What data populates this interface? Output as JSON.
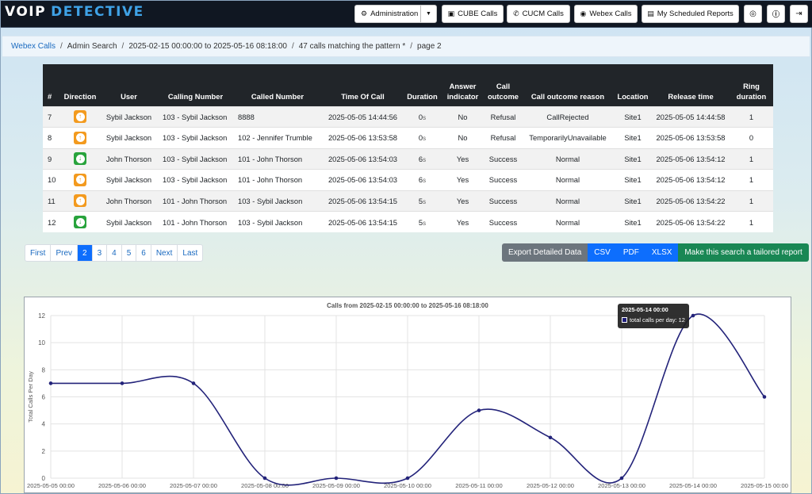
{
  "app": {
    "logo_a": "VOIP",
    "logo_b": "DETECTIVE"
  },
  "nav": {
    "administration": "Administration",
    "cube_calls": "CUBE Calls",
    "cucm_calls": "CUCM Calls",
    "webex_calls": "Webex Calls",
    "scheduled_reports": "My Scheduled Reports"
  },
  "breadcrumb": {
    "items": [
      "Webex Calls",
      "Admin Search",
      "2025-02-15 00:00:00 to 2025-05-16 08:18:00",
      "47 calls matching the pattern *",
      "page 2"
    ]
  },
  "table": {
    "headers": [
      "#",
      "Direction",
      "User",
      "Calling Number",
      "Called Number",
      "Time Of Call",
      "Duration",
      "Answer indicator",
      "Call outcome",
      "Call outcome reason",
      "Location",
      "Release time",
      "Ring duration"
    ],
    "rows": [
      {
        "num": "7",
        "direction": "outgoing",
        "user": "Sybil Jackson",
        "calling": "103 - Sybil Jackson",
        "called": "8888",
        "time": "2025-05-05 14:44:56",
        "duration": "0",
        "unit": "s",
        "answer": "No",
        "outcome": "Refusal",
        "reason": "CallRejected",
        "location": "Site1",
        "release": "2025-05-05 14:44:58",
        "ring": "1"
      },
      {
        "num": "8",
        "direction": "outgoing",
        "user": "Sybil Jackson",
        "calling": "103 - Sybil Jackson",
        "called": "102 - Jennifer Trumble",
        "time": "2025-05-06 13:53:58",
        "duration": "0",
        "unit": "s",
        "answer": "No",
        "outcome": "Refusal",
        "reason": "TemporarilyUnavailable",
        "location": "Site1",
        "release": "2025-05-06 13:53:58",
        "ring": "0"
      },
      {
        "num": "9",
        "direction": "incoming",
        "user": "John Thorson",
        "calling": "103 - Sybil Jackson",
        "called": "101 - John Thorson",
        "time": "2025-05-06 13:54:03",
        "duration": "6",
        "unit": "s",
        "answer": "Yes",
        "outcome": "Success",
        "reason": "Normal",
        "location": "Site1",
        "release": "2025-05-06 13:54:12",
        "ring": "1"
      },
      {
        "num": "10",
        "direction": "outgoing",
        "user": "Sybil Jackson",
        "calling": "103 - Sybil Jackson",
        "called": "101 - John Thorson",
        "time": "2025-05-06 13:54:03",
        "duration": "6",
        "unit": "s",
        "answer": "Yes",
        "outcome": "Success",
        "reason": "Normal",
        "location": "Site1",
        "release": "2025-05-06 13:54:12",
        "ring": "1"
      },
      {
        "num": "11",
        "direction": "outgoing",
        "user": "John Thorson",
        "calling": "101 - John Thorson",
        "called": "103 - Sybil Jackson",
        "time": "2025-05-06 13:54:15",
        "duration": "5",
        "unit": "s",
        "answer": "Yes",
        "outcome": "Success",
        "reason": "Normal",
        "location": "Site1",
        "release": "2025-05-06 13:54:22",
        "ring": "1"
      },
      {
        "num": "12",
        "direction": "incoming",
        "user": "Sybil Jackson",
        "calling": "101 - John Thorson",
        "called": "103 - Sybil Jackson",
        "time": "2025-05-06 13:54:15",
        "duration": "5",
        "unit": "s",
        "answer": "Yes",
        "outcome": "Success",
        "reason": "Normal",
        "location": "Site1",
        "release": "2025-05-06 13:54:22",
        "ring": "1"
      }
    ]
  },
  "pagination": {
    "first": "First",
    "prev": "Prev",
    "pages": [
      "2",
      "3",
      "4",
      "5",
      "6"
    ],
    "current": "2",
    "next": "Next",
    "last": "Last"
  },
  "export": {
    "label": "Export Detailed Data",
    "csv": "CSV",
    "pdf": "PDF",
    "xlsx": "XLSX",
    "tailored": "Make this search a tailored report"
  },
  "chart_data": {
    "type": "line",
    "title": "Calls from 2025-02-15 00:00:00 to 2025-05-16 08:18:00",
    "ylabel": "Total Calls Per Day",
    "xlabel": "",
    "categories": [
      "2025-05-05 00:00",
      "2025-05-06 00:00",
      "2025-05-07 00:00",
      "2025-05-08 00:00",
      "2025-05-09 00:00",
      "2025-05-10 00:00",
      "2025-05-11 00:00",
      "2025-05-12 00:00",
      "2025-05-13 00:00",
      "2025-05-14 00:00",
      "2025-05-15 00:00"
    ],
    "series": [
      {
        "name": "total calls per day",
        "values": [
          7,
          7,
          7,
          0,
          0,
          0,
          5,
          3,
          0,
          12,
          6
        ],
        "color": "#23237a"
      }
    ],
    "ylim": [
      0,
      12
    ],
    "yticks": [
      0,
      2,
      4,
      6,
      8,
      10,
      12
    ],
    "grid": true,
    "tooltip": {
      "title": "2025-05-14 00:00",
      "label": "total calls per day: 12"
    }
  }
}
